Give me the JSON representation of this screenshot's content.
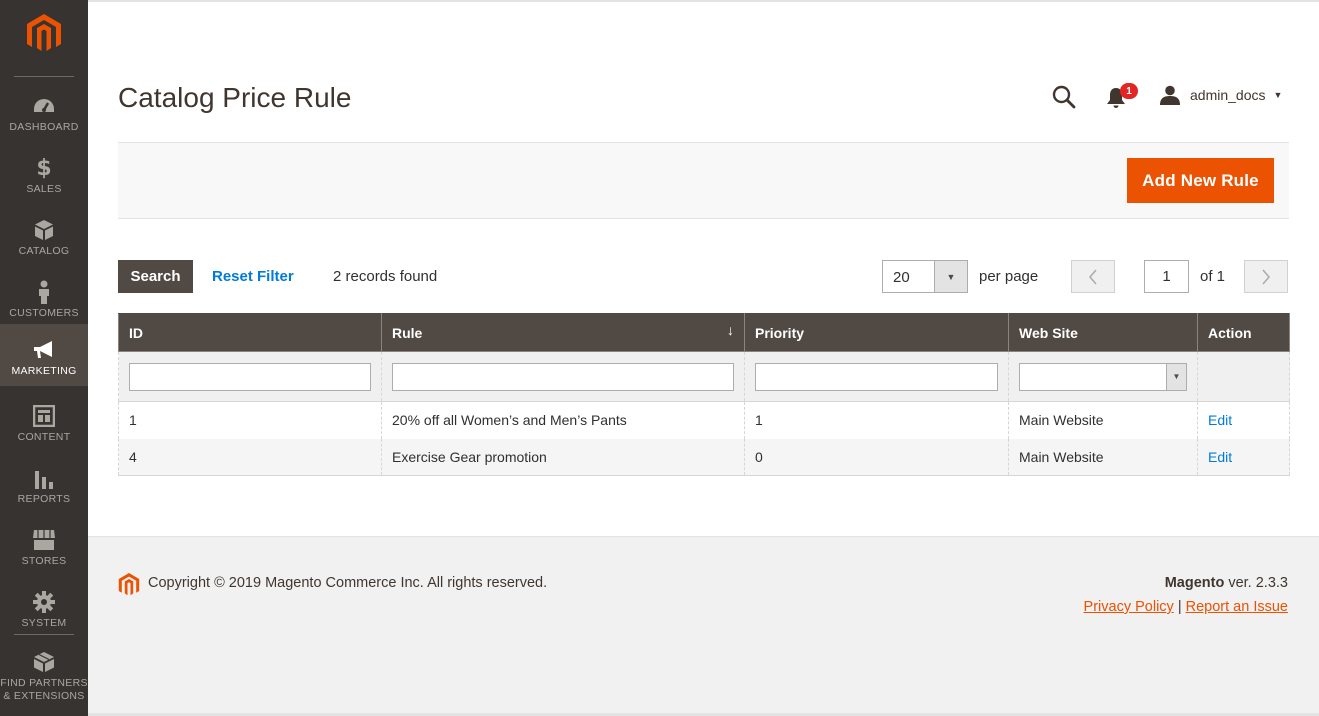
{
  "sidebar": {
    "items": [
      {
        "label": "DASHBOARD",
        "icon": "dashboard-icon"
      },
      {
        "label": "SALES",
        "icon": "dollar-icon"
      },
      {
        "label": "CATALOG",
        "icon": "box-icon"
      },
      {
        "label": "CUSTOMERS",
        "icon": "person-icon"
      },
      {
        "label": "MARKETING",
        "icon": "megaphone-icon",
        "active": true
      },
      {
        "label": "CONTENT",
        "icon": "layout-icon"
      },
      {
        "label": "REPORTS",
        "icon": "bar-chart-icon"
      },
      {
        "label": "STORES",
        "icon": "store-icon"
      },
      {
        "label": "SYSTEM",
        "icon": "gear-icon"
      },
      {
        "label": "FIND PARTNERS",
        "label2": "& EXTENSIONS",
        "icon": "extensions-icon"
      }
    ]
  },
  "header": {
    "title": "Catalog Price Rule",
    "notification_count": "1",
    "username": "admin_docs"
  },
  "actions": {
    "add_label": "Add New Rule"
  },
  "toolbar": {
    "search_label": "Search",
    "reset_label": "Reset Filter",
    "records_text": "2 records found",
    "per_page_value": "20",
    "per_page_label": "per page",
    "page_value": "1",
    "page_of": "of 1"
  },
  "grid": {
    "columns": [
      "ID",
      "Rule",
      "Priority",
      "Web Site",
      "Action"
    ],
    "sort_indicator": "↓",
    "rows": [
      {
        "id": "1",
        "rule": "20% off all Women’s and Men’s Pants",
        "priority": "1",
        "website": "Main Website",
        "action": "Edit"
      },
      {
        "id": "4",
        "rule": "Exercise Gear promotion",
        "priority": "0",
        "website": "Main Website",
        "action": "Edit"
      }
    ]
  },
  "footer": {
    "copyright": "Copyright © 2019 Magento Commerce Inc. All rights reserved.",
    "brand": "Magento",
    "version": " ver. 2.3.3",
    "privacy_label": "Privacy Policy",
    "separator": " | ",
    "report_label": "Report an Issue"
  },
  "colors": {
    "sidebar_bg": "#373330",
    "accent": "#eb5202",
    "header_bg": "#514943",
    "link": "#007bdb"
  }
}
